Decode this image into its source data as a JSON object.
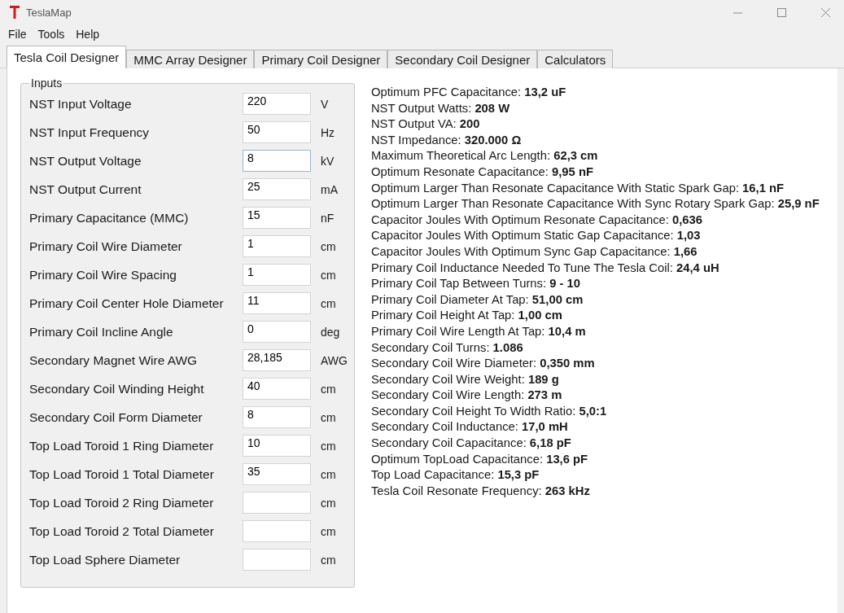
{
  "window": {
    "title": "TeslaMap"
  },
  "menu": [
    "File",
    "Tools",
    "Help"
  ],
  "tabs": [
    {
      "label": "Tesla Coil Designer",
      "selected": true
    },
    {
      "label": "MMC Array Designer",
      "selected": false
    },
    {
      "label": "Primary Coil Designer",
      "selected": false
    },
    {
      "label": "Secondary Coil Designer",
      "selected": false
    },
    {
      "label": "Calculators",
      "selected": false
    }
  ],
  "inputs": {
    "title": "Inputs",
    "rows": [
      {
        "label": "NST Input Voltage",
        "value": "220",
        "unit": "V",
        "focused": false
      },
      {
        "label": "NST Input Frequency",
        "value": "50",
        "unit": "Hz",
        "focused": false
      },
      {
        "label": "NST Output Voltage",
        "value": "8",
        "unit": "kV",
        "focused": true
      },
      {
        "label": "NST Output Current",
        "value": "25",
        "unit": "mA",
        "focused": false
      },
      {
        "label": "Primary Capacitance (MMC)",
        "value": "15",
        "unit": "nF",
        "focused": false
      },
      {
        "label": "Primary Coil Wire Diameter",
        "value": "1",
        "unit": "cm",
        "focused": false
      },
      {
        "label": "Primary Coil Wire Spacing",
        "value": "1",
        "unit": "cm",
        "focused": false
      },
      {
        "label": "Primary Coil Center Hole Diameter",
        "value": "11",
        "unit": "cm",
        "focused": false
      },
      {
        "label": "Primary Coil Incline Angle",
        "value": "0",
        "unit": "deg",
        "focused": false
      },
      {
        "label": "Secondary Magnet Wire AWG",
        "value": "28,185",
        "unit": "AWG",
        "focused": false
      },
      {
        "label": "Secondary Coil Winding Height",
        "value": "40",
        "unit": "cm",
        "focused": false
      },
      {
        "label": "Secondary Coil Form Diameter",
        "value": "8",
        "unit": "cm",
        "focused": false
      },
      {
        "label": "Top Load Toroid 1 Ring Diameter",
        "value": "10",
        "unit": "cm",
        "focused": false
      },
      {
        "label": "Top Load Toroid 1 Total Diameter",
        "value": "35",
        "unit": "cm",
        "focused": false
      },
      {
        "label": "Top Load Toroid 2 Ring Diameter",
        "unit": "cm",
        "focused": false
      },
      {
        "label": "Top Load Toroid 2 Total Diameter",
        "unit": "cm",
        "focused": false
      },
      {
        "label": "Top Load Sphere Diameter",
        "unit": "cm",
        "focused": false
      }
    ]
  },
  "results": [
    "Optimum PFC Capacitance: **13,2 uF**",
    "NST Output Watts: **208 W**",
    "NST Output VA: **200**",
    "NST Impedance: **320.000 Ω**",
    "Maximum Theoretical Arc Length: **62,3 cm**",
    "Optimum Resonate Capacitance: **9,95 nF**",
    "Optimum Larger Than Resonate Capacitance With Static Spark Gap: **16,1 nF**",
    "Optimum Larger Than Resonate Capacitance With Sync Rotary Spark Gap: **25,9 nF**",
    "Capacitor Joules With Optimum Resonate Capacitance: **0,636**",
    "Capacitor Joules With Optimum Static Gap Capacitance: **1,03**",
    "Capacitor Joules With Optimum Sync Gap Capacitance: **1,66**",
    "Primary Coil Inductance Needed To Tune The Tesla Coil: **24,4 uH**",
    "Primary Coil Tap Between Turns: **9 - 10**",
    "Primary Coil Diameter At Tap: **51,00 cm**",
    "Primary Coil Height At Tap: **1,00 cm**",
    "Primary Coil Wire Length At Tap: **10,4 m**",
    "Secondary Coil Turns: **1.086**",
    "Secondary Coil Wire Diameter: **0,350 mm**",
    "Secondary Coil Wire Weight: **189 g**",
    "Secondary Coil Wire Length: **273 m**",
    "Secondary Coil Height To Width Ratio: **5,0:1**",
    "Secondary Coil Inductance: **17,0 mH**",
    "Secondary Coil Capacitance: **6,18 pF**",
    "Optimum TopLoad Capacitance: **13,6 pF**",
    "Top Load Capacitance: **15,3 pF**",
    "Tesla Coil Resonate Frequency: **263 kHz**"
  ]
}
